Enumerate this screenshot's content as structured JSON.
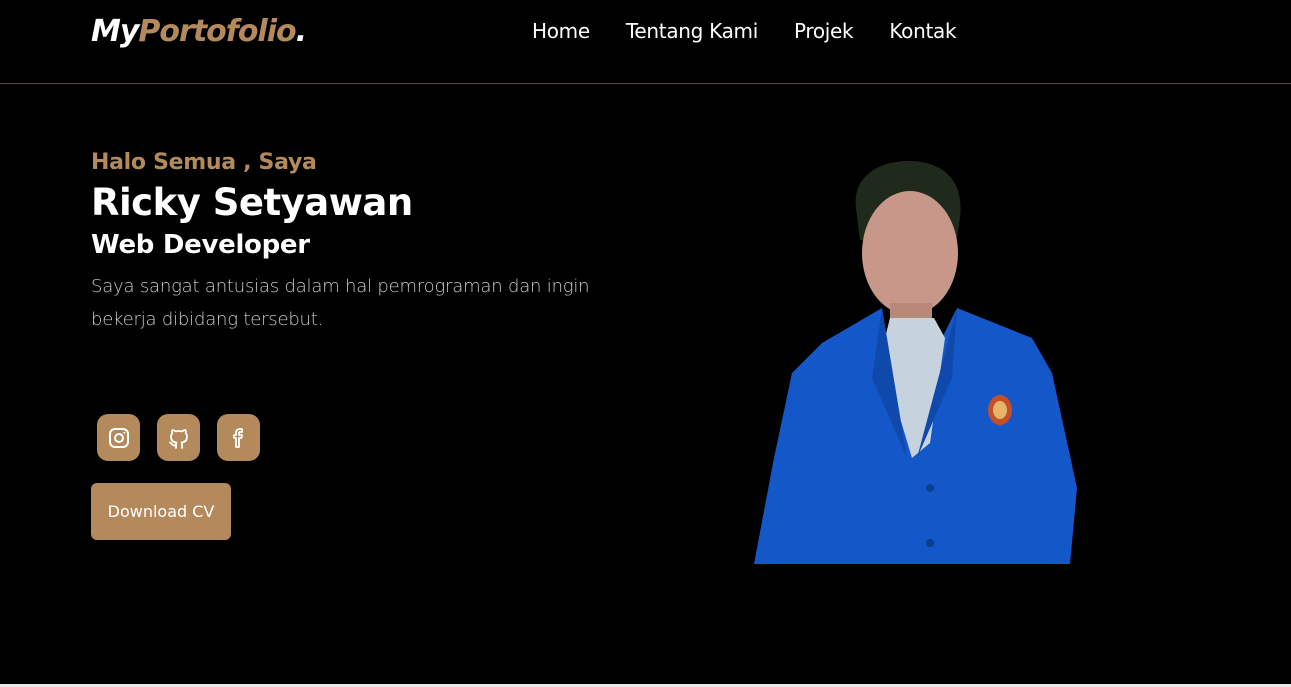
{
  "logo": {
    "part1": "My",
    "part2": "Portofolio",
    "part3": "."
  },
  "nav": {
    "items": [
      {
        "label": "Home"
      },
      {
        "label": "Tentang Kami"
      },
      {
        "label": "Projek"
      },
      {
        "label": "Kontak"
      }
    ]
  },
  "hero": {
    "greeting": "Halo Semua , Saya",
    "name": "Ricky Setyawan",
    "role": "Web Developer",
    "description": "Saya sangat antusias dalam hal pemrograman dan ingin bekerja dibidang tersebut."
  },
  "socials": [
    {
      "icon": "instagram-icon"
    },
    {
      "icon": "github-icon"
    },
    {
      "icon": "facebook-icon"
    }
  ],
  "cta": {
    "download_label": "Download CV"
  },
  "colors": {
    "accent": "#b48a5c",
    "background": "#000000",
    "text": "#ffffff"
  }
}
